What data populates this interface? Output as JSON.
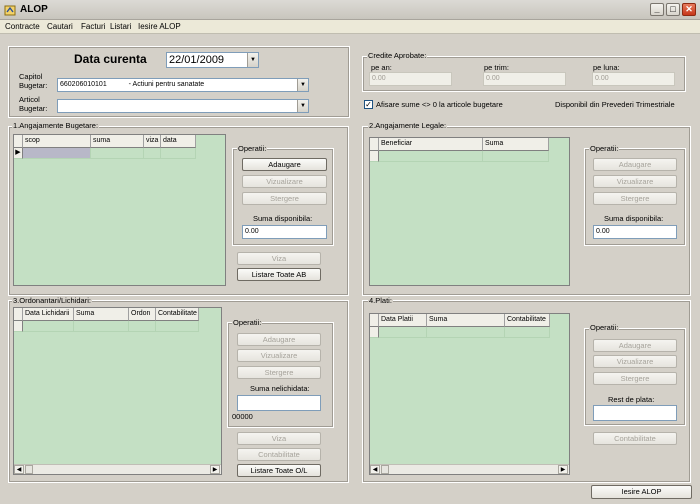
{
  "window": {
    "title": "ALOP",
    "minimize": "_",
    "maximize": "□",
    "close": "✕"
  },
  "menu": [
    "Contracte",
    "Cautari",
    "Facturi",
    "Listari",
    "Iesire ALOP"
  ],
  "header": {
    "date_title": "Data curenta",
    "date_value": "22/01/2009",
    "capitol_label_1": "Capitol",
    "capitol_label_2": "Bugetar:",
    "capitol_code": "660206010101",
    "capitol_text": "- Actiuni pentru sanatate",
    "articol_label_1": "Articol",
    "articol_label_2": "Bugetar:",
    "articol_value": ""
  },
  "credite": {
    "title": "Credite Aprobate:",
    "pe_an_label": "pe an:",
    "pe_an_value": "0.00",
    "pe_trim_label": "pe trim:",
    "pe_trim_value": "0.00",
    "pe_luna_label": "pe luna:",
    "pe_luna_value": "0.00",
    "checkbox_label": "Afisare sume <> 0 la articole bugetare",
    "checkbox_checked": true,
    "disponibil_text": "Disponibil din Prevederi Trimestriale"
  },
  "panel1": {
    "title": "1.Angajamente Bugetare:",
    "columns": [
      "scop",
      "suma",
      "viza",
      "data"
    ],
    "ops_title": "Operatii:",
    "btn_add": "Adaugare",
    "btn_view": "Vizualizare",
    "btn_delete": "Stergere",
    "suma_label": "Suma disponibila:",
    "suma_value": "0.00",
    "btn_viza": "Viza",
    "btn_list": "Listare Toate AB"
  },
  "panel2": {
    "title": "2.Angajamente Legale:",
    "columns": [
      "Beneficiar",
      "Suma"
    ],
    "ops_title": "Operatii:",
    "btn_add": "Adaugare",
    "btn_view": "Vizualizare",
    "btn_delete": "Stergere",
    "suma_label": "Suma disponibila:",
    "suma_value": "0.00"
  },
  "panel3": {
    "title": "3.Ordonantari/Lichidari:",
    "columns": [
      "Data Lichidarii",
      "Suma",
      "Ordon",
      "Contabilitate"
    ],
    "ops_title": "Operatii:",
    "btn_add": "Adaugare",
    "btn_view": "Vizualizare",
    "btn_delete": "Stergere",
    "suma_label": "Suma nelichidata:",
    "suma_value": "",
    "counter": "00000",
    "btn_viza": "Viza",
    "btn_contab": "Contabilitate",
    "btn_list": "Listare Toate O/L"
  },
  "panel4": {
    "title": "4.Plati:",
    "columns": [
      "Data Platii",
      "Suma",
      "Contabilitate"
    ],
    "ops_title": "Operatii:",
    "btn_add": "Adaugare",
    "btn_view": "Vizualizare",
    "btn_delete": "Stergere",
    "rest_label": "Rest de plata:",
    "rest_value": "",
    "btn_contab": "Contabilitate"
  },
  "footer": {
    "exit_button": "Iesire ALOP"
  }
}
